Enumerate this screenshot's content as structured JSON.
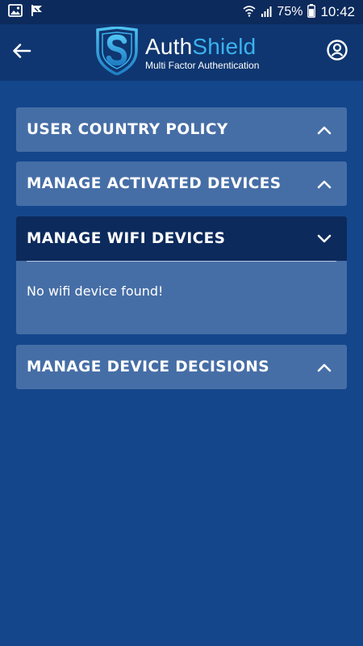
{
  "status_bar": {
    "battery_percent": "75%",
    "time": "10:42",
    "icons": [
      "image-icon",
      "flag-icon",
      "wifi-icon",
      "signal-icon",
      "battery-icon"
    ]
  },
  "app_bar": {
    "logo_title_part1": "Auth",
    "logo_title_part2": "Shield",
    "logo_subtitle": "Multi Factor Authentication",
    "back_icon": "back-arrow-icon",
    "profile_icon": "user-profile-icon"
  },
  "colors": {
    "background": "#14468c",
    "appbar": "#0f3670",
    "panel": "#466ea6",
    "panel_expanded_header": "#0c2a5c",
    "brand_accent": "#3bb2ee"
  },
  "sections": [
    {
      "title": "USER COUNTRY POLICY",
      "expanded": false
    },
    {
      "title": "MANAGE ACTIVATED DEVICES",
      "expanded": false
    },
    {
      "title": "MANAGE WIFI DEVICES",
      "expanded": true,
      "body_text": "No wifi device found!"
    },
    {
      "title": "MANAGE DEVICE DECISIONS",
      "expanded": false
    }
  ]
}
